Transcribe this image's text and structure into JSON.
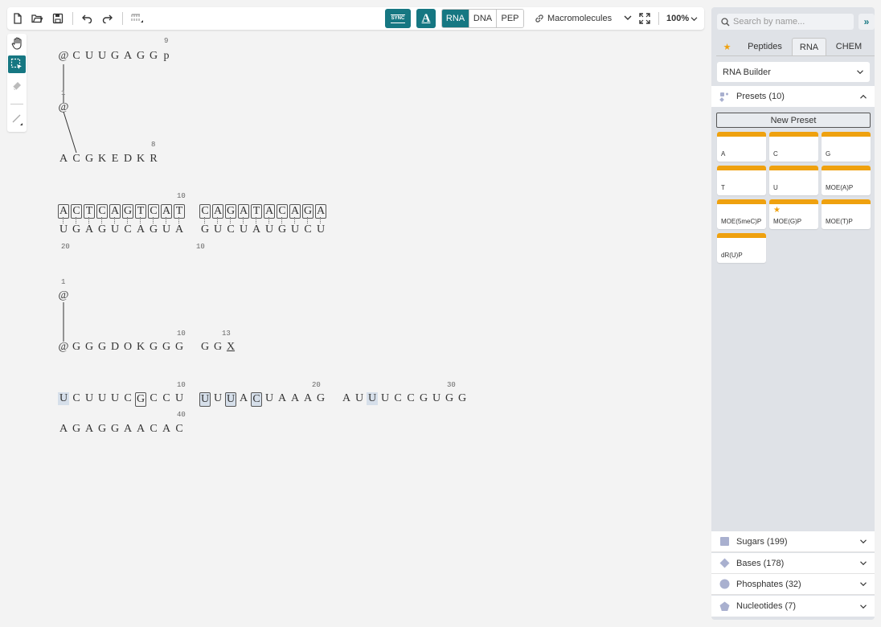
{
  "toolbar": {
    "sync_label": "SYNC",
    "type_modes": [
      "RNA",
      "DNA",
      "PEP"
    ],
    "active_type": "RNA",
    "layout_mode": "Macromolecules",
    "zoom": "100%"
  },
  "canvas": {
    "block1": {
      "top_num": "9",
      "top_seq": [
        "@",
        "C",
        "U",
        "U",
        "G",
        "A",
        "G",
        "G",
        "p"
      ],
      "mid_num": "1",
      "mid_seq": "@",
      "bot_num": "8",
      "bot_seq": [
        "A",
        "C",
        "G",
        "K",
        "E",
        "D",
        "K",
        "R"
      ]
    },
    "block2": {
      "num_top": "10",
      "top": [
        "A",
        "C",
        "T",
        "C",
        "A",
        "G",
        "T",
        "C",
        "A",
        "T",
        " ",
        "C",
        "A",
        "G",
        "A",
        "T",
        "A",
        "C",
        "A",
        "G",
        "A"
      ],
      "bottom": [
        "U",
        "G",
        "A",
        "G",
        "U",
        "C",
        "A",
        "G",
        "U",
        "A",
        " ",
        "G",
        "U",
        "C",
        "U",
        "A",
        "U",
        "G",
        "U",
        "C",
        "U"
      ],
      "num_b1": "20",
      "num_b2": "10"
    },
    "block3": {
      "n1": "1",
      "at": "@",
      "n10": "10",
      "n13": "13",
      "seq": [
        "@",
        "G",
        "G",
        "G",
        "D",
        "O",
        "K",
        "G",
        "G",
        "G",
        " ",
        "G",
        "G",
        "X"
      ]
    },
    "block4": {
      "n10": "10",
      "n20": "20",
      "n30": "30",
      "n40": "40",
      "seq1": [
        "U",
        "C",
        "U",
        "U",
        "U",
        "C",
        "G",
        "C",
        "C",
        "U",
        " ",
        "U",
        "U",
        "U",
        "A",
        "C",
        "U",
        "A",
        "A",
        "A",
        "G",
        " ",
        "A",
        "U",
        "U",
        "U",
        "C",
        "C",
        "G",
        "U",
        "G",
        "G"
      ],
      "seq2": [
        "A",
        "G",
        "A",
        "G",
        "G",
        "A",
        "A",
        "C",
        "A",
        "C"
      ]
    }
  },
  "panel": {
    "search_placeholder": "Search by name...",
    "tabs": [
      "Peptides",
      "RNA",
      "CHEM"
    ],
    "active_tab": "RNA",
    "builder_label": "RNA Builder",
    "presets_label": "Presets (10)",
    "new_preset_label": "New Preset",
    "presets": [
      "A",
      "C",
      "G",
      "T",
      "U",
      "MOE(A)P",
      "MOE(5meC)P",
      "MOE(G)P",
      "MOE(T)P",
      "dR(U)P"
    ],
    "sections": [
      "Sugars (199)",
      "Bases (178)",
      "Phosphates (32)",
      "Nucleotides (7)"
    ]
  },
  "colors": {
    "accent": "#167782",
    "preset_bar": "#efa10f",
    "highlight": "#d6dfea"
  }
}
